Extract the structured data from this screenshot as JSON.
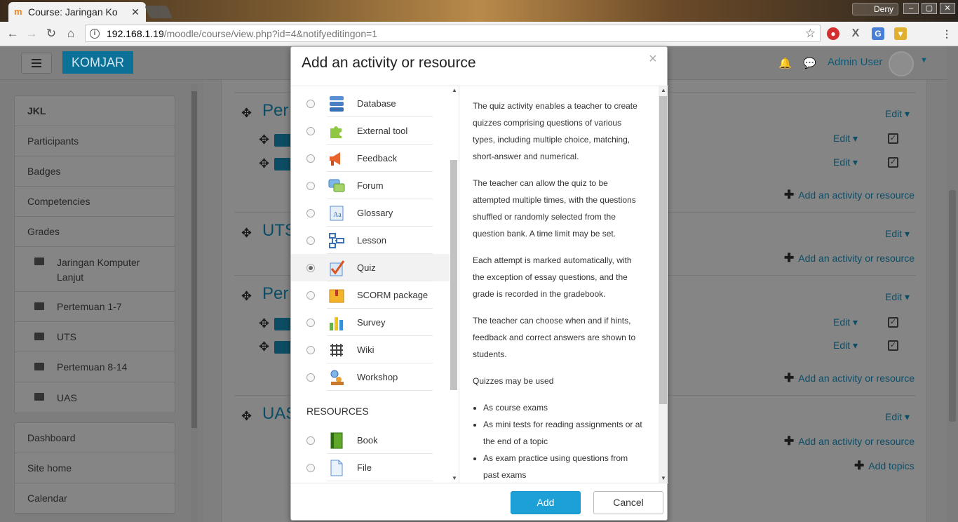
{
  "browser": {
    "tab_title": "Course: Jaringan Ko",
    "tab_favicon": "m",
    "profile_name": "Deny",
    "url_host": "192.168.1.19",
    "url_path": "/moodle/course/view.php?id=4&notifyeditingon=1"
  },
  "navbar": {
    "brand": "KOMJAR",
    "user_name": "Admin User"
  },
  "drawer": {
    "course_items": [
      {
        "label": "JKL"
      },
      {
        "label": "Participants"
      },
      {
        "label": "Badges"
      },
      {
        "label": "Competencies"
      },
      {
        "label": "Grades"
      },
      {
        "label": "Jaringan Komputer Lanjut"
      },
      {
        "label": "Pertemuan 1-7"
      },
      {
        "label": "UTS"
      },
      {
        "label": "Pertemuan 8-14"
      },
      {
        "label": "UAS"
      }
    ],
    "site_items": [
      {
        "label": "Dashboard"
      },
      {
        "label": "Site home"
      },
      {
        "label": "Calendar"
      }
    ]
  },
  "course": {
    "sections": [
      {
        "title": "Per"
      },
      {
        "title": "UTS"
      },
      {
        "title": "Per"
      },
      {
        "title": "UAS"
      }
    ],
    "edit_label": "Edit",
    "add_activity_label": "Add an activity or resource",
    "add_topics_label": "Add topics"
  },
  "modal": {
    "title": "Add an activity or resource",
    "activities": [
      {
        "label": "Database",
        "icon": "database-icon"
      },
      {
        "label": "External tool",
        "icon": "puzzle-icon"
      },
      {
        "label": "Feedback",
        "icon": "megaphone-icon"
      },
      {
        "label": "Forum",
        "icon": "forum-icon"
      },
      {
        "label": "Glossary",
        "icon": "glossary-icon"
      },
      {
        "label": "Lesson",
        "icon": "lesson-icon"
      },
      {
        "label": "Quiz",
        "icon": "quiz-icon",
        "selected": true
      },
      {
        "label": "SCORM package",
        "icon": "scorm-icon"
      },
      {
        "label": "Survey",
        "icon": "survey-icon"
      },
      {
        "label": "Wiki",
        "icon": "wiki-icon"
      },
      {
        "label": "Workshop",
        "icon": "workshop-icon"
      }
    ],
    "resources_heading": "RESOURCES",
    "resources": [
      {
        "label": "Book",
        "icon": "book-icon"
      },
      {
        "label": "File",
        "icon": "file-icon"
      }
    ],
    "description": {
      "p1": "The quiz activity enables a teacher to create quizzes comprising questions of various types, including multiple choice, matching, short-answer and numerical.",
      "p2": "The teacher can allow the quiz to be attempted multiple times, with the questions shuffled or randomly selected from the question bank. A time limit may be set.",
      "p3": "Each attempt is marked automatically, with the exception of essay questions, and the grade is recorded in the gradebook.",
      "p4": "The teacher can choose when and if hints, feedback and correct answers are shown to students.",
      "p5": "Quizzes may be used",
      "uses": [
        "As course exams",
        "As mini tests for reading assignments or at the end of a topic",
        "As exam practice using questions from past exams"
      ]
    },
    "add_button": "Add",
    "cancel_button": "Cancel"
  },
  "colors": {
    "link": "#0f6cbf",
    "brand": "#1ca0d6",
    "primary_button": "#1ca0d6"
  }
}
